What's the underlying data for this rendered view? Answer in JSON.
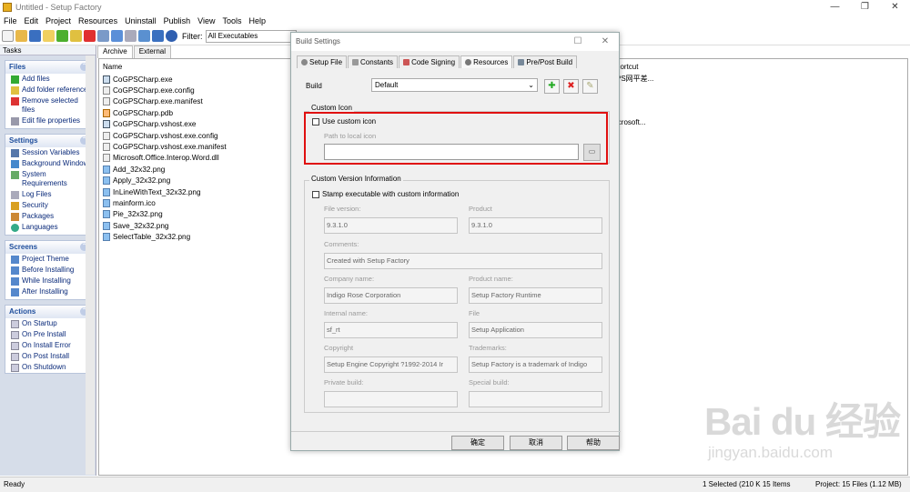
{
  "window": {
    "title": "Untitled - Setup Factory",
    "buttons": [
      "—",
      "❐",
      "✕"
    ]
  },
  "menu": [
    "File",
    "Edit",
    "Project",
    "Resources",
    "Uninstall",
    "Publish",
    "View",
    "Tools",
    "Help"
  ],
  "toolbar": {
    "filter_label": "Filter:",
    "filter_value": "All Executables"
  },
  "tasks": {
    "header": "Tasks",
    "groups": [
      {
        "title": "Files",
        "items": [
          "Add files",
          "Add folder reference",
          "Remove selected files",
          "Edit file properties"
        ]
      },
      {
        "title": "Settings",
        "items": [
          "Session Variables",
          "Background Window",
          "System Requirements",
          "Log Files",
          "Security",
          "Packages",
          "Languages"
        ]
      },
      {
        "title": "Screens",
        "items": [
          "Project Theme",
          "Before Installing",
          "While Installing",
          "After Installing"
        ]
      },
      {
        "title": "Actions",
        "items": [
          "On Startup",
          "On Pre Install",
          "On Install Error",
          "On Post Install",
          "On Shutdown"
        ]
      }
    ]
  },
  "tabs": {
    "archive": "Archive",
    "external": "External"
  },
  "filelist": {
    "col_name": "Name",
    "col_shortcut": "hortcut",
    "shortcut_cells": [
      "PS网平差...",
      "",
      "",
      "",
      "icrosoft..."
    ],
    "files": [
      {
        "name": "CoGPSCharp.exe",
        "kind": "exe"
      },
      {
        "name": "CoGPSCharp.exe.config",
        "kind": "doc"
      },
      {
        "name": "CoGPSCharp.exe.manifest",
        "kind": "doc"
      },
      {
        "name": "CoGPSCharp.pdb",
        "kind": "pdb"
      },
      {
        "name": "CoGPSCharp.vshost.exe",
        "kind": "exe"
      },
      {
        "name": "CoGPSCharp.vshost.exe.config",
        "kind": "doc"
      },
      {
        "name": "CoGPSCharp.vshost.exe.manifest",
        "kind": "doc"
      },
      {
        "name": "Microsoft.Office.Interop.Word.dll",
        "kind": "doc"
      },
      {
        "name": "Add_32x32.png",
        "kind": "img"
      },
      {
        "name": "Apply_32x32.png",
        "kind": "img"
      },
      {
        "name": "InLineWithText_32x32.png",
        "kind": "img"
      },
      {
        "name": "mainform.ico",
        "kind": "img"
      },
      {
        "name": "Pie_32x32.png",
        "kind": "img"
      },
      {
        "name": "Save_32x32.png",
        "kind": "img"
      },
      {
        "name": "SelectTable_32x32.png",
        "kind": "img"
      }
    ]
  },
  "status": {
    "left": "Ready",
    "selected": "1 Selected (210 K 15 Items",
    "project": "Project: 15 Files (1.12 MB)"
  },
  "dialog": {
    "title": "Build Settings",
    "tabs": [
      "Setup File",
      "Constants",
      "Code Signing",
      "Resources",
      "Pre/Post Build"
    ],
    "build_label": "Build",
    "build_value": "Default",
    "custom_icon_group": "Custom Icon",
    "use_custom_icon": "Use custom icon",
    "path_label": "Path to local icon",
    "version_group": "Custom Version Information",
    "stamp_label": "Stamp executable with custom information",
    "fields": {
      "file_version": {
        "label": "File version:",
        "value": "9.3.1.0"
      },
      "product": {
        "label": "Product",
        "value": "9.3.1.0"
      },
      "comments": {
        "label": "Comments:",
        "value": "Created with Setup Factory"
      },
      "company": {
        "label": "Company name:",
        "value": "Indigo Rose Corporation"
      },
      "product_name": {
        "label": "Product name:",
        "value": "Setup Factory Runtime"
      },
      "internal": {
        "label": "Internal name:",
        "value": "sf_rt"
      },
      "file": {
        "label": "File",
        "value": "Setup Application"
      },
      "copyright": {
        "label": "Copyright",
        "value": "Setup Engine Copyright ?1992-2014 Ir"
      },
      "trademarks": {
        "label": "Trademarks:",
        "value": "Setup Factory is a trademark of Indigo"
      },
      "private": {
        "label": "Private build:",
        "value": ""
      },
      "special": {
        "label": "Special build:",
        "value": ""
      }
    },
    "ok": "确定",
    "cancel": "取消",
    "help": "帮助"
  },
  "watermark": {
    "logo": "Bai du 经验",
    "url": "jingyan.baidu.com"
  },
  "colors": {
    "highlight": "#e01010",
    "task_title": "#1f4e9c"
  }
}
